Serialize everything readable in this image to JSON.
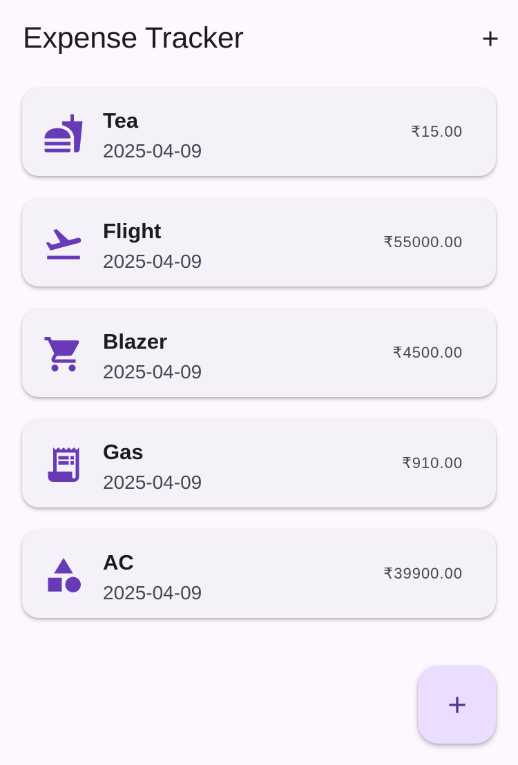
{
  "app": {
    "title": "Expense Tracker",
    "add_action_icon": "add-icon",
    "accent_color": "#673ab7",
    "background_color": "#fdf7ff"
  },
  "expenses": [
    {
      "title": "Tea",
      "date": "2025-04-09",
      "amount": "₹15.00",
      "icon": "fastfood-icon"
    },
    {
      "title": "Flight",
      "date": "2025-04-09",
      "amount": "₹55000.00",
      "icon": "flight-takeoff-icon"
    },
    {
      "title": "Blazer",
      "date": "2025-04-09",
      "amount": "₹4500.00",
      "icon": "shopping-cart-icon"
    },
    {
      "title": "Gas",
      "date": "2025-04-09",
      "amount": "₹910.00",
      "icon": "receipt-icon"
    },
    {
      "title": "AC",
      "date": "2025-04-09",
      "amount": "₹39900.00",
      "icon": "category-icon"
    }
  ],
  "fab": {
    "icon": "add-icon",
    "color": "#eaddff"
  }
}
